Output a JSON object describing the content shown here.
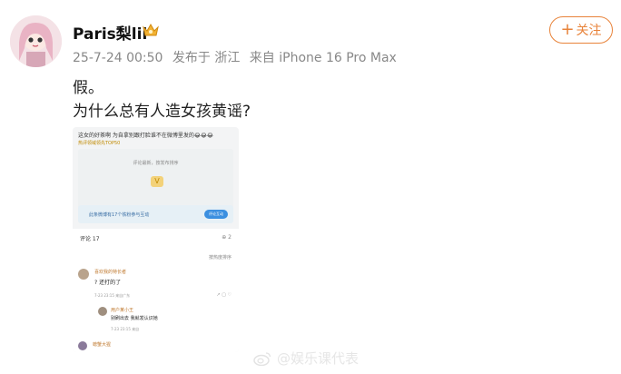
{
  "post": {
    "username": "Paris梨lii",
    "timestamp": "25-7-24 00:50",
    "location": "发布于 浙江",
    "device": "来自 iPhone 16 Pro Max",
    "follow_label": "关注",
    "follow_plus": "+",
    "lines": [
      "假。",
      "为什么总有人造女孩黄谣?"
    ]
  },
  "screenshot": {
    "header": "这女的好茶啊 为自拿别跟打脸谁不在微博里发的😂😂😂",
    "hot": "热评领域领先TOP50",
    "card_text": "评论最新，按发布排序",
    "card_logo": "V",
    "bar_text": "此条微博有17个铁粉参与互动",
    "bar_button": "评论互动",
    "comments_count": "评论 17",
    "share_count": "⊕ 2",
    "sort_label": "按热度排序",
    "comment1_name": "喜欢我的特长者",
    "comment1_text": "? 还打的了",
    "comment1_date": "7-23 23:15 来自广东",
    "comment1_icons": "↗  ▢  ♡",
    "reply1_name": "用户某小王",
    "reply1_text": "别刷出去 我就发认识她",
    "reply1_date": "7-23 23:15 来自",
    "comment2_name": "螃蟹大猩"
  },
  "watermark": "@娱乐课代表",
  "colors": {
    "accent": "#e8833a",
    "meta": "#888888",
    "weibo_blue": "#3b8fe0"
  }
}
